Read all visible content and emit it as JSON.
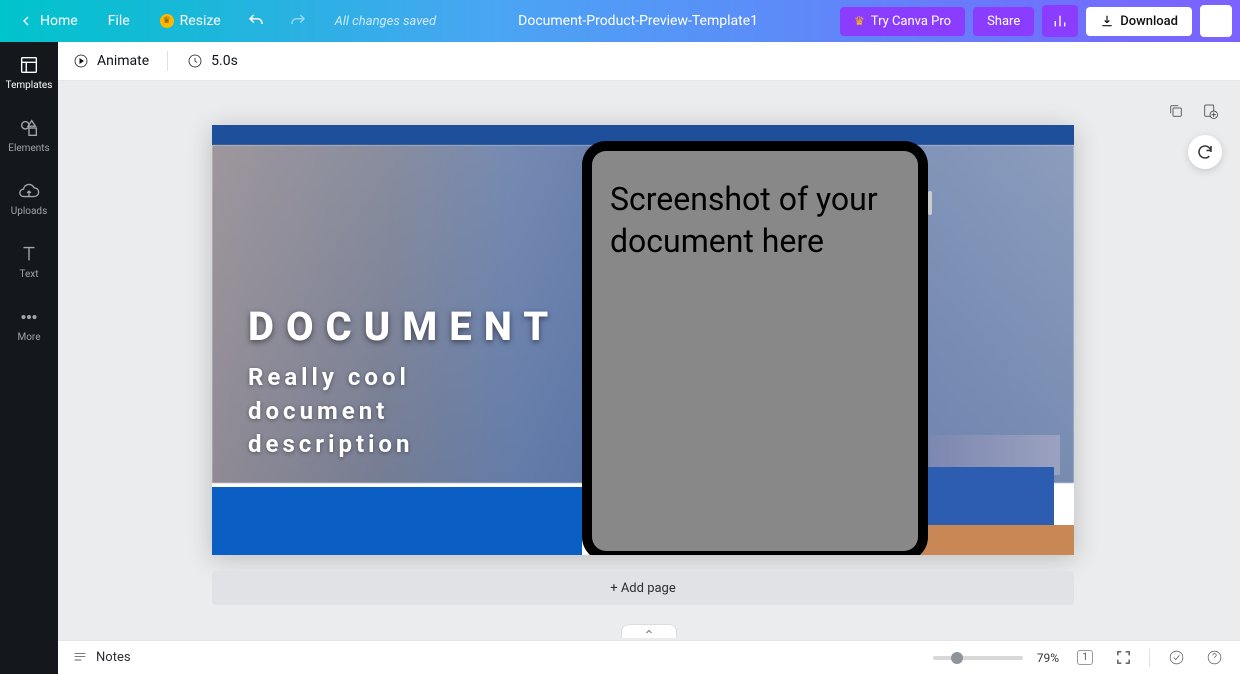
{
  "topbar": {
    "home": "Home",
    "file": "File",
    "resize": "Resize",
    "saved": "All changes saved",
    "doc_title": "Document-Product-Preview-Template1",
    "try_pro": "Try Canva Pro",
    "share": "Share",
    "download": "Download"
  },
  "sidebar": {
    "items": [
      {
        "label": "Templates"
      },
      {
        "label": "Elements"
      },
      {
        "label": "Uploads"
      },
      {
        "label": "Text"
      },
      {
        "label": "More"
      }
    ]
  },
  "subbar": {
    "animate": "Animate",
    "duration": "5.0s"
  },
  "canvas": {
    "heading": "DOCUMENT",
    "subheading": "Really cool document description",
    "tablet_text": "Screenshot of your document here",
    "add_page": "+ Add page"
  },
  "bottombar": {
    "notes": "Notes",
    "zoom": "79%",
    "page_badge": "1"
  }
}
